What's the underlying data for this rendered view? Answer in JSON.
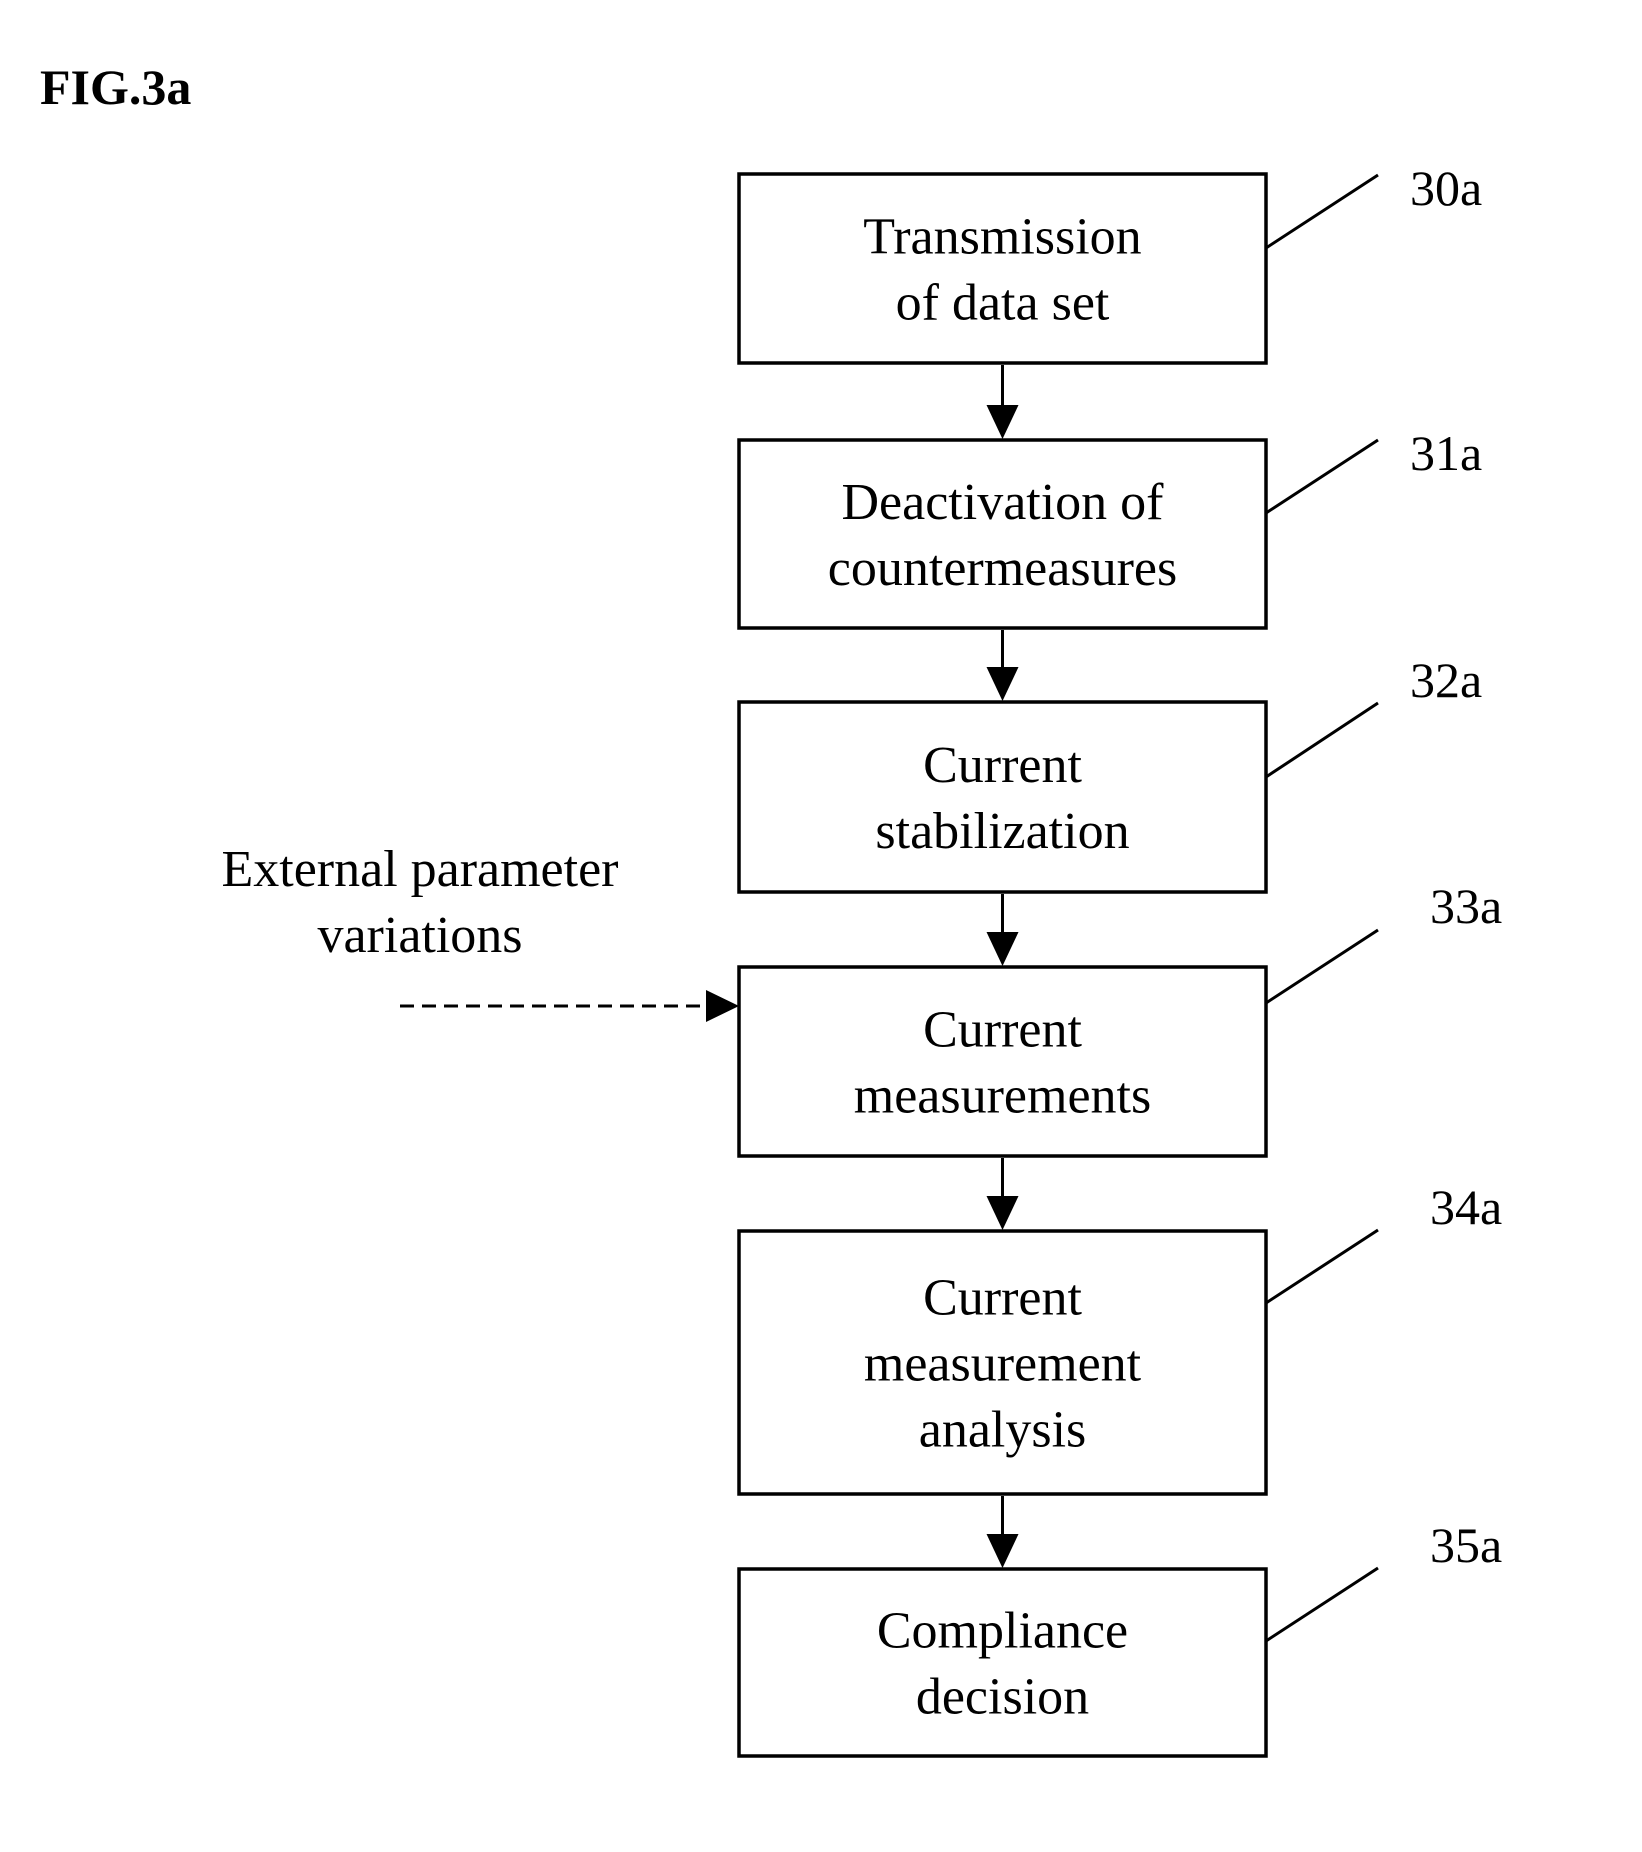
{
  "figure": {
    "title": "FIG.3a"
  },
  "steps": [
    {
      "ref": "30a",
      "lines": [
        "Transmission",
        "of data set"
      ]
    },
    {
      "ref": "31a",
      "lines": [
        "Deactivation of",
        "countermeasures"
      ]
    },
    {
      "ref": "32a",
      "lines": [
        "Current",
        "stabilization"
      ]
    },
    {
      "ref": "33a",
      "lines": [
        "Current",
        "measurements"
      ]
    },
    {
      "ref": "34a",
      "lines": [
        "Current",
        "measurement",
        "analysis"
      ]
    },
    {
      "ref": "35a",
      "lines": [
        "Compliance",
        "decision"
      ]
    }
  ],
  "external_input": {
    "lines": [
      "External parameter",
      "variations"
    ],
    "target_step": "33a",
    "style": "dashed"
  },
  "colors": {
    "stroke": "#000000",
    "background": "#ffffff"
  }
}
